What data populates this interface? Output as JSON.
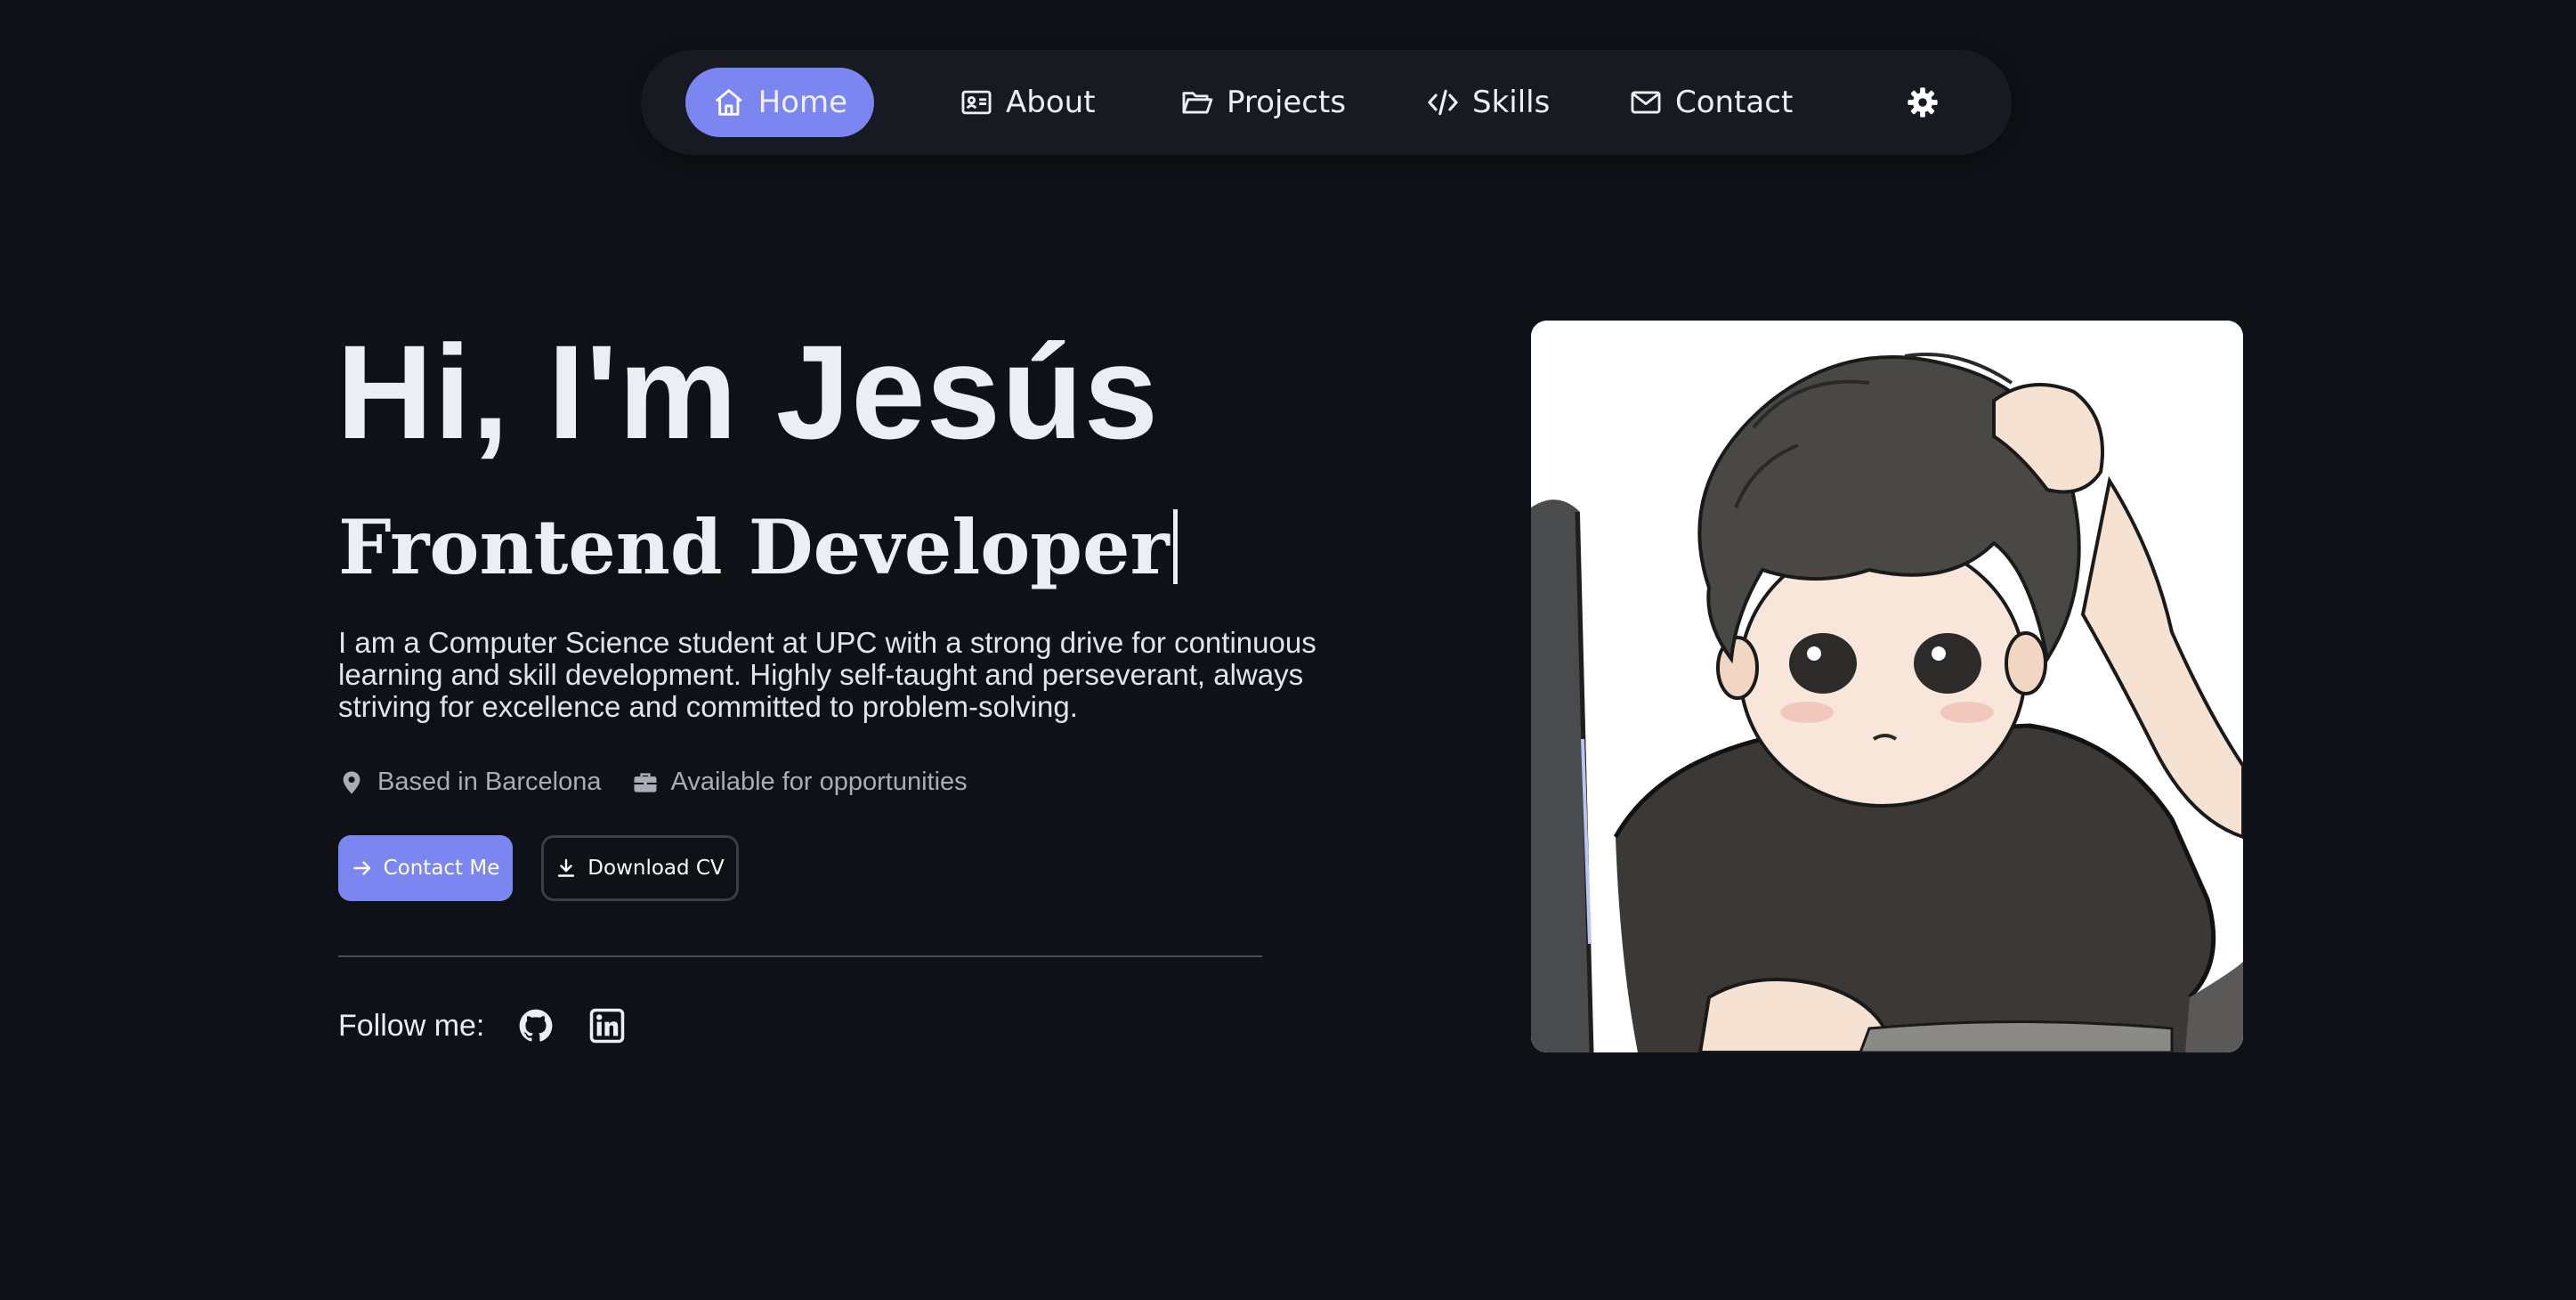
{
  "nav": {
    "items": [
      {
        "label": "Home",
        "icon": "home-icon",
        "active": true
      },
      {
        "label": "About",
        "icon": "id-card-icon",
        "active": false
      },
      {
        "label": "Projects",
        "icon": "folder-icon",
        "active": false
      },
      {
        "label": "Skills",
        "icon": "code-icon",
        "active": false
      },
      {
        "label": "Contact",
        "icon": "mail-icon",
        "active": false
      }
    ],
    "theme_icon": "gear-icon"
  },
  "hero": {
    "title": "Hi, I'm Jesús",
    "role": "Frontend Developer",
    "description": "I am a Computer Science student at UPC with a strong drive for continuous learning and skill development. Highly self-taught and perseverant, always striving for excellence and committed to problem-solving.",
    "location": "Based in Barcelona",
    "availability": "Available for opportunities"
  },
  "buttons": {
    "contact": "Contact Me",
    "download": "Download CV"
  },
  "social": {
    "follow_label": "Follow me:",
    "links": [
      "github-icon",
      "linkedin-icon"
    ]
  },
  "colors": {
    "background": "#0e1116",
    "navbar": "#171a21",
    "accent": "#7c86f0",
    "text": "#eceef3",
    "muted": "#a8adb8"
  }
}
